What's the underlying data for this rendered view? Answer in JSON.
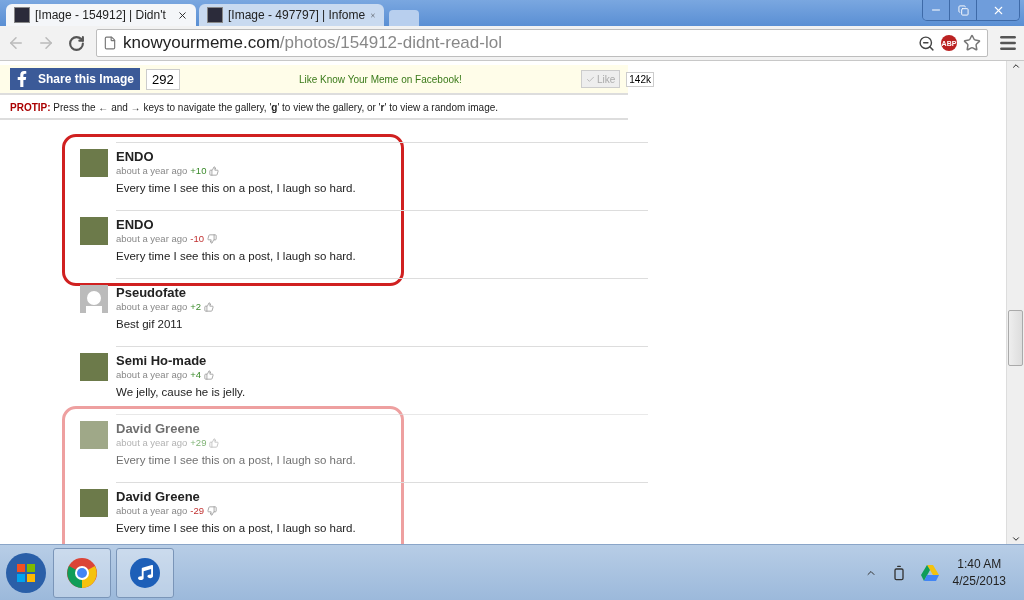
{
  "browser": {
    "tabs": [
      {
        "title": "[Image - 154912] | Didn't",
        "selected": true
      },
      {
        "title": "[Image - 497797] | Infome",
        "selected": false
      }
    ],
    "url": {
      "domain": "knowyourmeme.com",
      "path": "/photos/154912-didnt-read-lol"
    },
    "adblock_badge": "ABP"
  },
  "share_bar": {
    "button": "Share this Image",
    "count": "292",
    "promo": "Like Know Your Meme on Facebook!",
    "like_button": "Like",
    "like_count": "142k"
  },
  "protip": "**PROTIP:** Press the ← and → keys to navigate the gallery, '**g**' to view the gallery, or '**r**' to view a random image.",
  "comment_groups": [
    {
      "kind": "strong",
      "comments": [
        {
          "author": "ENDO",
          "time": "about a year ago",
          "score": "+10",
          "upvoted": true,
          "text": "Every time I see this on a post, I laugh so hard.",
          "default_avatar": false,
          "faded": false
        },
        {
          "author": "ENDO",
          "time": "about a year ago",
          "score": "-10",
          "upvoted": false,
          "text": "Every time I see this on a post, I laugh so hard.",
          "default_avatar": false,
          "faded": false
        }
      ]
    },
    {
      "kind": "plain",
      "comments": [
        {
          "author": "Pseudofate",
          "time": "about a year ago",
          "score": "+2",
          "upvoted": true,
          "text": "Best gif 2011",
          "default_avatar": true,
          "faded": false
        },
        {
          "author": "Semi Ho-made",
          "time": "about a year ago",
          "score": "+4",
          "upvoted": true,
          "text": "We jelly, cause he is jelly.",
          "default_avatar": false,
          "faded": false
        }
      ]
    },
    {
      "kind": "faint",
      "comments": [
        {
          "author": "David Greene",
          "time": "about a year ago",
          "score": "+29",
          "upvoted": true,
          "text": "Every time I see this on a post, I laugh so hard.",
          "default_avatar": false,
          "faded": true
        },
        {
          "author": "David Greene",
          "time": "about a year ago",
          "score": "-29",
          "upvoted": false,
          "text": "Every time I see this on a post, I laugh so hard.",
          "default_avatar": false,
          "faded": false
        }
      ]
    }
  ],
  "taskbar": {
    "clock_time": "1:40 AM",
    "clock_date": "4/25/2013"
  }
}
